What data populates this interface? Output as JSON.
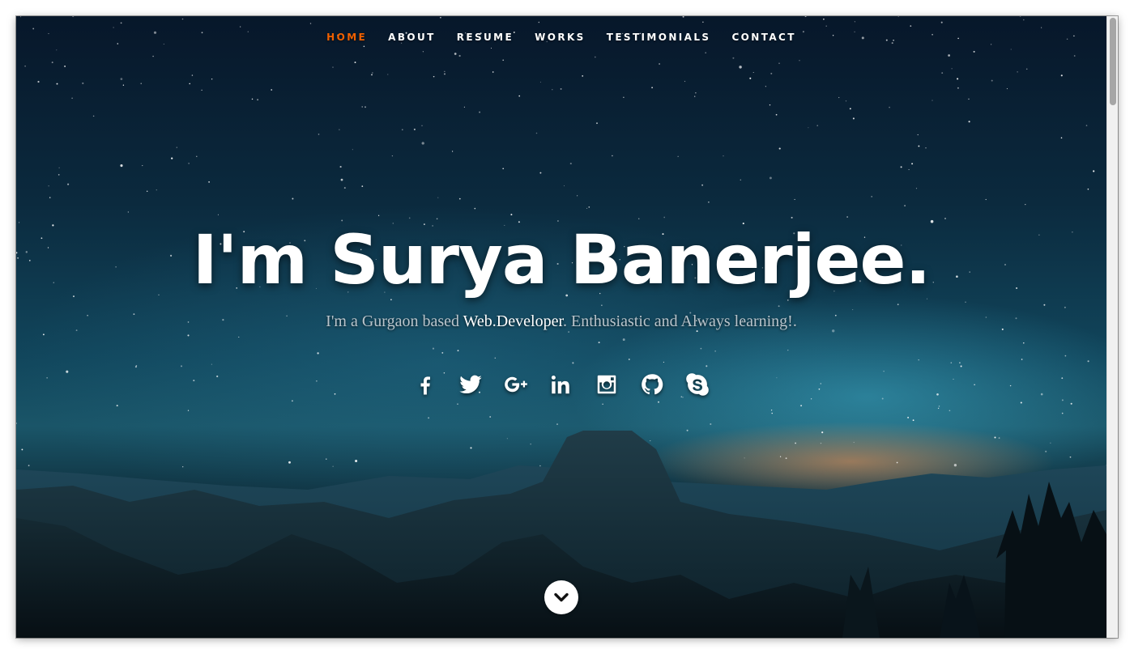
{
  "nav": {
    "items": [
      {
        "label": "HOME",
        "active": true
      },
      {
        "label": "ABOUT",
        "active": false
      },
      {
        "label": "RESUME",
        "active": false
      },
      {
        "label": "WORKS",
        "active": false
      },
      {
        "label": "TESTIMONIALS",
        "active": false
      },
      {
        "label": "CONTACT",
        "active": false
      }
    ]
  },
  "hero": {
    "headline": "I'm Surya Banerjee.",
    "tagline_prefix": "I'm a Gurgaon based",
    "tagline_highlight": "Web.Developer",
    "tagline_suffix": ". Enthusiastic and Always learning!."
  },
  "social": [
    {
      "icon": "facebook-icon"
    },
    {
      "icon": "twitter-icon"
    },
    {
      "icon": "google-plus-icon"
    },
    {
      "icon": "linkedin-icon"
    },
    {
      "icon": "instagram-icon"
    },
    {
      "icon": "github-icon"
    },
    {
      "icon": "skype-icon"
    }
  ],
  "scroll_down": {
    "icon": "chevron-down-icon"
  },
  "colors": {
    "accent": "#f06000",
    "text": "#ffffff",
    "tagline": "#b9c4cb"
  }
}
